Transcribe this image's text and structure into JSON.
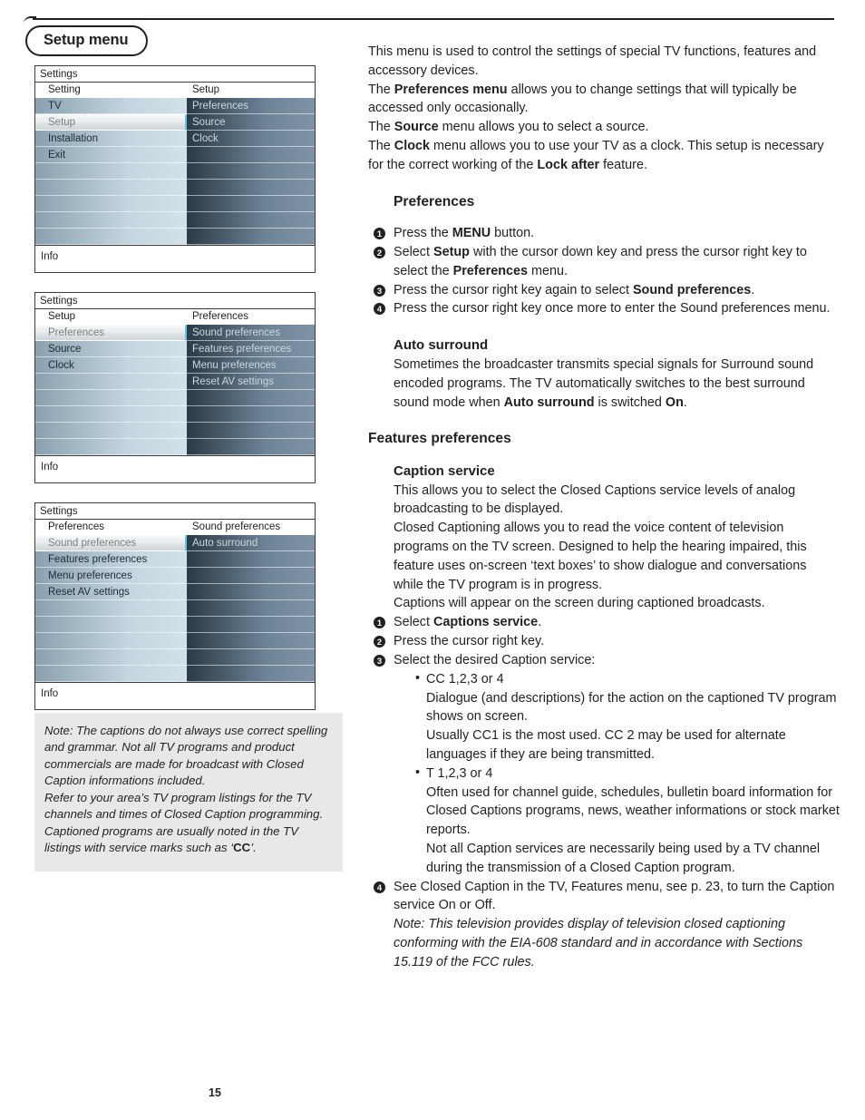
{
  "section_tab": "Setup menu",
  "page_number": "15",
  "osd_menus": [
    {
      "title": "Settings",
      "left_header": "Setting",
      "right_header": "Setup",
      "left_items": [
        "TV",
        "Setup",
        "Installation",
        "Exit"
      ],
      "left_selected_index": 1,
      "right_items": [
        "Preferences",
        "Source",
        "Clock"
      ],
      "footer": "Info"
    },
    {
      "title": "Settings",
      "left_header": "Setup",
      "right_header": "Preferences",
      "left_items": [
        "Preferences",
        "Source",
        "Clock"
      ],
      "left_selected_index": 0,
      "right_items": [
        "Sound preferences",
        "Features preferences",
        "Menu preferences",
        "Reset AV settings"
      ],
      "footer": "Info"
    },
    {
      "title": "Settings",
      "left_header": "Preferences",
      "right_header": "Sound preferences",
      "left_items": [
        "Sound preferences",
        "Features preferences",
        "Menu preferences",
        "Reset AV settings"
      ],
      "left_selected_index": 0,
      "right_items": [
        "Auto surround"
      ],
      "footer": "Info"
    }
  ],
  "note_box": {
    "line1": "Note: The captions do not always use correct spelling and grammar. Not all TV programs and product commercials are made for broadcast with Closed Caption informations included.",
    "line2": "Refer to your area’s TV program listings for the TV channels and times of Closed Caption programming. Captioned programs are usually noted in the TV listings with service marks such as ‘",
    "cc_mark": "CC",
    "line2_end": "’."
  },
  "intro": {
    "p1": "This menu is used to control the settings of special TV functions, features and accessory devices.",
    "p2_pre": "The ",
    "p2_bold": "Preferences menu",
    "p2_post": " allows you to change settings that will typically be accessed only occasionally.",
    "p3_pre": "The ",
    "p3_bold": "Source",
    "p3_post": " menu allows you to select a source.",
    "p4_pre": "The ",
    "p4_bold": "Clock",
    "p4_mid": " menu allows you to use your TV as a clock. This setup is necessary for the correct working of the ",
    "p4_bold2": "Lock after",
    "p4_post": " feature."
  },
  "preferences": {
    "heading": "Preferences",
    "steps": [
      {
        "num": "1",
        "pre": "Press the ",
        "bold": "MENU",
        "post": " button."
      },
      {
        "num": "2",
        "pre": "Select ",
        "bold": "Setup",
        "mid": " with the cursor down key and press the cursor right key to select the ",
        "bold2": "Preferences",
        "post": " menu."
      },
      {
        "num": "3",
        "pre": "Press the cursor right key again to select ",
        "bold": "Sound preferences",
        "post": "."
      },
      {
        "num": "4",
        "pre": "Press the cursor right key once more to enter the Sound preferences menu.",
        "bold": "",
        "post": ""
      }
    ]
  },
  "auto_surround": {
    "heading": "Auto surround",
    "body_pre": "Sometimes the broadcaster transmits special signals for Surround sound encoded programs. The TV automatically switches to the best surround sound mode when ",
    "body_bold": "Auto surround",
    "body_mid": " is switched ",
    "body_bold2": "On",
    "body_post": "."
  },
  "features_preferences": {
    "heading": "Features preferences",
    "caption_service": {
      "heading": "Caption service",
      "p1": "This allows you to select the Closed Captions service levels of analog broadcasting to be displayed.",
      "p2": "Closed Captioning allows you to read the voice content of television programs on the TV screen. Designed to help the hearing impaired, this feature uses on-screen ‘text boxes’ to show dialogue and conversations while the TV program is in progress.",
      "p3": "Captions will appear on the screen during captioned broadcasts.",
      "steps": [
        {
          "num": "1",
          "pre": "Select ",
          "bold": "Captions service",
          "post": "."
        },
        {
          "num": "2",
          "pre": "Press the cursor right key.",
          "bold": "",
          "post": ""
        },
        {
          "num": "3",
          "pre": "Select the desired Caption service:",
          "bold": "",
          "post": ""
        }
      ],
      "bullets": [
        {
          "label": "CC 1,2,3 or 4",
          "lines": [
            "Dialogue (and descriptions) for the action on the captioned TV program shows on screen.",
            "Usually CC1 is the most used. CC 2 may be used for alternate languages if they are being transmitted."
          ]
        },
        {
          "label": "T 1,2,3 or 4",
          "lines": [
            "Often used for channel guide, schedules, bulletin board information for Closed Captions programs, news, weather informations or stock market reports.",
            "Not all Caption services are necessarily being used by a TV channel during the transmission of a Closed Caption program."
          ]
        }
      ],
      "step4": {
        "num": "4",
        "text": "See Closed Caption in the TV, Features menu, see p. 23, to turn the Caption service On or Off."
      },
      "final_note": "Note: This television provides display of television closed captioning conforming with the EIA-608 standard and in accordance with Sections 15.119 of the FCC rules."
    }
  }
}
